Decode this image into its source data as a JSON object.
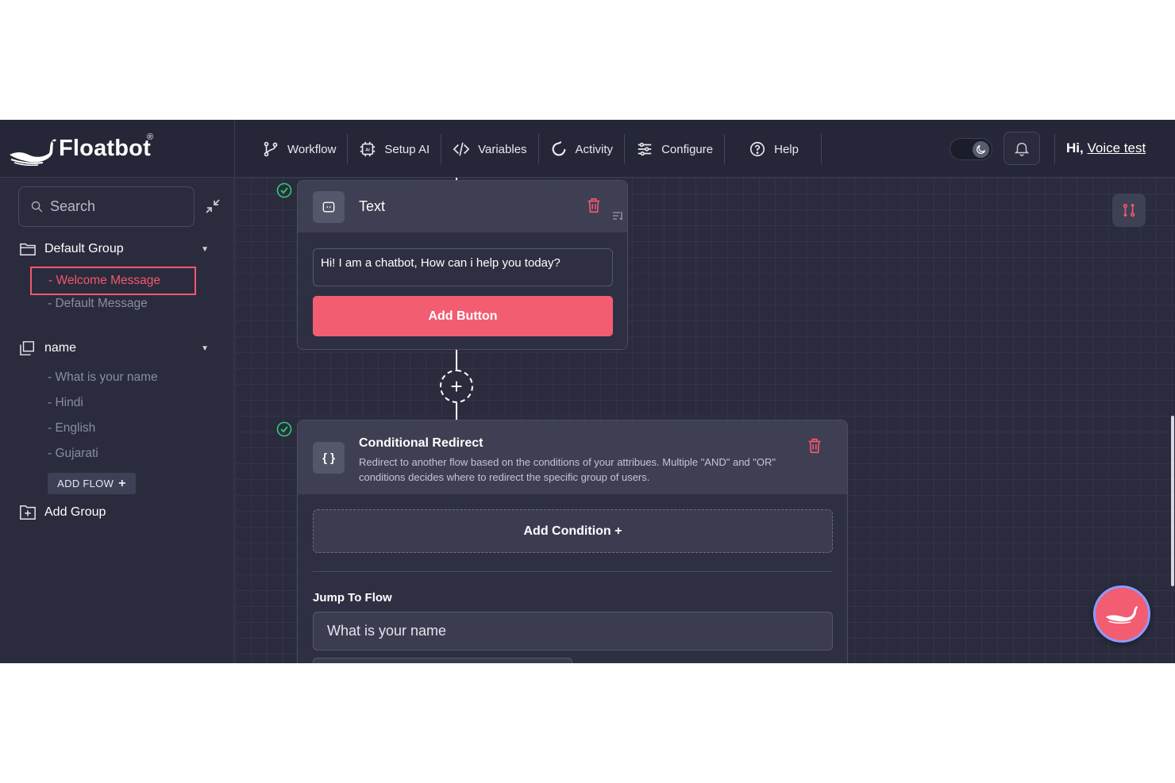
{
  "app": {
    "brand": "Floatbot",
    "registered_mark": "®"
  },
  "nav": {
    "items": [
      {
        "label": "Workflow",
        "icon": "workflow-branch-icon"
      },
      {
        "label": "Setup AI",
        "icon": "ai-chip-icon"
      },
      {
        "label": "Variables",
        "icon": "code-icon"
      },
      {
        "label": "Activity",
        "icon": "activity-refresh-icon"
      },
      {
        "label": "Configure",
        "icon": "sliders-icon"
      },
      {
        "label": "Help",
        "icon": "help-circle-icon"
      }
    ]
  },
  "user": {
    "greeting_prefix": "Hi,",
    "name": "Voice test"
  },
  "theme_toggle": {
    "mode": "dark",
    "icon": "moon-icon"
  },
  "sidebar": {
    "search_placeholder": "Search",
    "groups": [
      {
        "name": "Default Group",
        "icon": "folder-icon",
        "flows": [
          "- Welcome Message",
          "- Default Message"
        ],
        "active_flow": "- Welcome Message"
      },
      {
        "name": "name",
        "icon": "copy-folder-icon",
        "flows": [
          "- What is your name",
          "- Hindi",
          "- English",
          "- Gujarati"
        ]
      }
    ],
    "add_flow_label": "ADD FLOW",
    "add_flow_plus": "+",
    "add_group_label": "Add Group"
  },
  "canvas": {
    "text_card": {
      "title": "Text",
      "message": "Hi! I am a chatbot, How can i help you today?",
      "add_button_label": "Add Button"
    },
    "plus_node": "+",
    "conditional_card": {
      "title": "Conditional Redirect",
      "icon_text": "{ }",
      "description": "Redirect to another flow based on the conditions of your attribues. Multiple \"AND\" and \"OR\" conditions decides where to redirect the specific group of users.",
      "add_condition_label": "Add Condition +",
      "jump_label": "Jump To Flow",
      "jump_value": "What is your name"
    }
  },
  "colors": {
    "accent": "#f25d72",
    "background": "#2a2b3d",
    "topbar": "#252637",
    "check": "#2ecc71"
  }
}
